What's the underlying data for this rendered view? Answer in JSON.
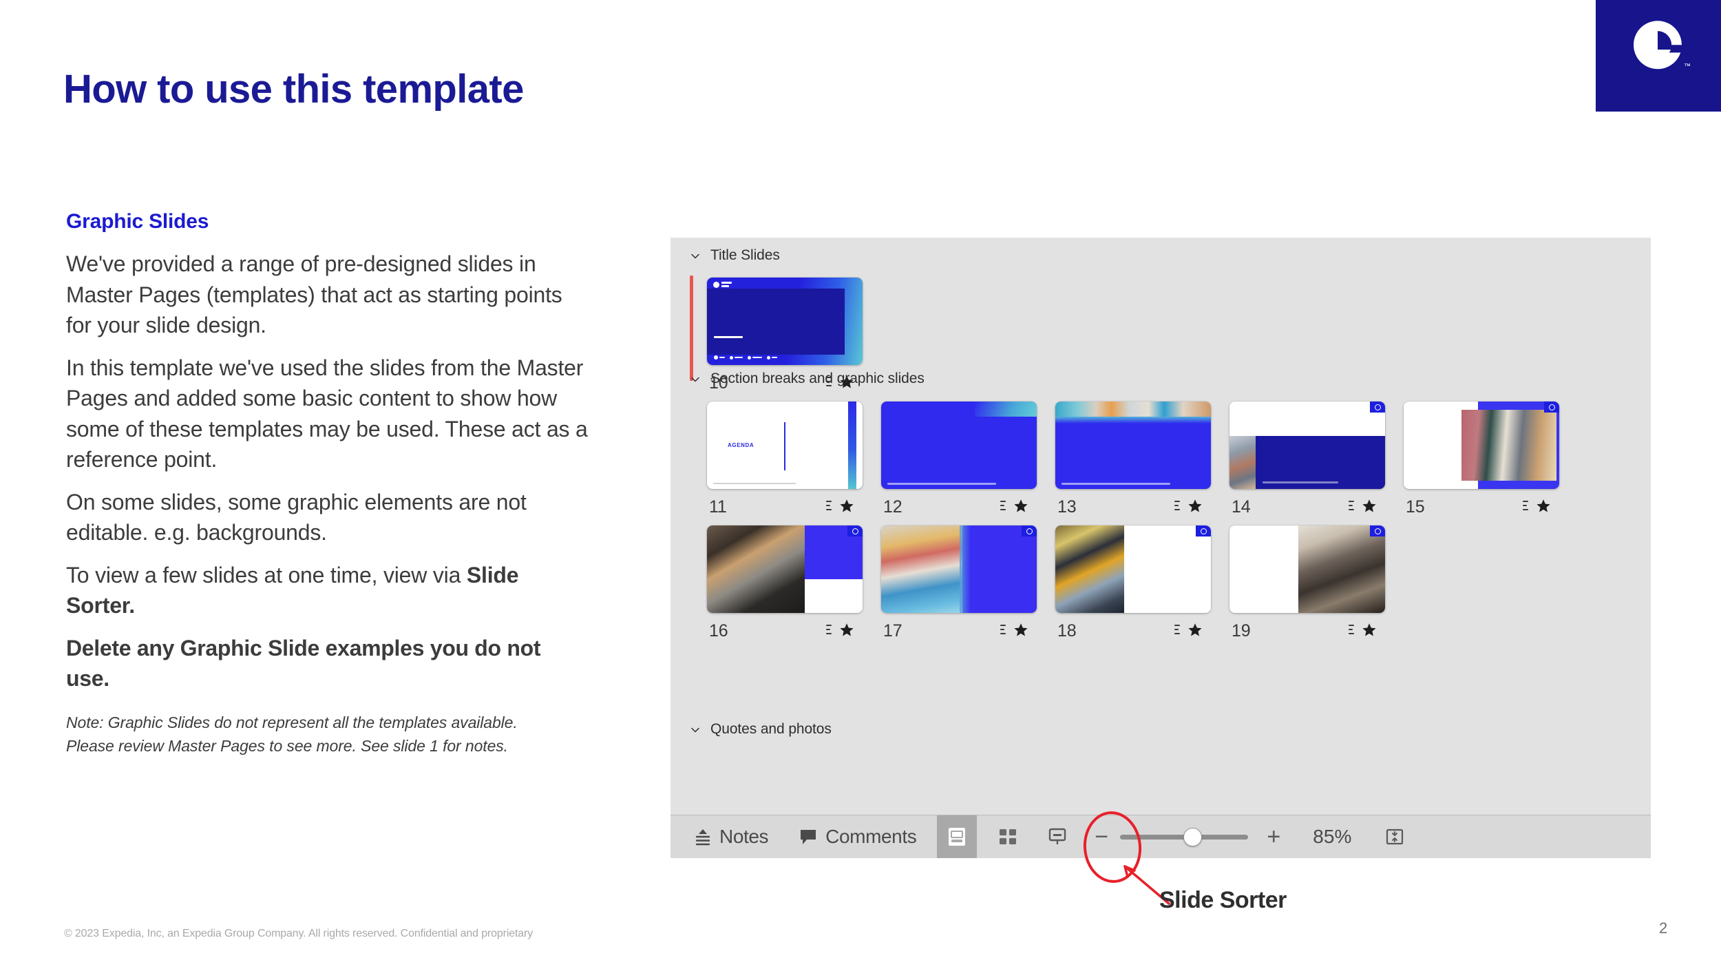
{
  "brand": {
    "logo_name": "expedia-e-logo",
    "logo_trademark": "™",
    "logo_bg": "#17148c",
    "title_color": "#1b1a95",
    "heading_color": "#1b1ad2",
    "accent_red": "#e8202a",
    "selection_red": "#e8574c"
  },
  "slide": {
    "title": "How to use this template",
    "page_number": "2",
    "footer": "© 2023 Expedia, Inc, an Expedia Group Company. All rights reserved. Confidential and proprietary"
  },
  "left_column": {
    "section_heading": "Graphic Slides",
    "paragraphs": [
      "We've provided a range of pre-designed slides in Master Pages (templates) that act as starting points for your slide design.",
      "In this template we've used the slides from the Master Pages and added some basic content to show how some of these templates may be used. These act as a reference point.",
      "On some slides, some graphic elements are not editable. e.g. backgrounds."
    ],
    "para_slide_sorter_prefix": "To view a few slides at one time, view via ",
    "para_slide_sorter_bold": "Slide Sorter.",
    "para_delete_bold": "Delete any Graphic Slide examples you do not use.",
    "note": "Note: Graphic Slides do not represent all the templates available. Please review Master Pages to see more. See slide 1 for notes."
  },
  "sorter": {
    "groups": [
      {
        "label": "Title Slides",
        "chevron": "chevron-down"
      },
      {
        "label": "Section breaks and graphic slides",
        "chevron": "chevron-down"
      },
      {
        "label": "Quotes and photos",
        "chevron": "chevron-down"
      }
    ],
    "thumbnails": [
      {
        "number": "10",
        "selected": true,
        "kind": "title-gradient"
      },
      {
        "number": "11",
        "selected": false,
        "kind": "agenda",
        "caption": "AGENDA"
      },
      {
        "number": "12",
        "selected": false,
        "kind": "solid-blue"
      },
      {
        "number": "13",
        "selected": false,
        "kind": "photo-top-blue"
      },
      {
        "number": "14",
        "selected": false,
        "kind": "navy-band-photo-left"
      },
      {
        "number": "15",
        "selected": false,
        "kind": "photo-right-framed"
      },
      {
        "number": "16",
        "selected": false,
        "kind": "photo-left-blue-right"
      },
      {
        "number": "17",
        "selected": false,
        "kind": "photo-left-blue-right-pool"
      },
      {
        "number": "18",
        "selected": false,
        "kind": "photo-left-white-right"
      },
      {
        "number": "19",
        "selected": false,
        "kind": "white-left-photo-right"
      }
    ],
    "badge_icons": [
      "transition-icon",
      "animation-star-icon"
    ]
  },
  "statusbar": {
    "notes_label": "Notes",
    "notes_icon": "notes-icon",
    "comments_label": "Comments",
    "comments_icon": "comment-bubble-icon",
    "view_normal_icon": "normal-view-icon",
    "view_sorter_icon": "slide-sorter-icon",
    "view_presenter_icon": "presenter-view-icon",
    "zoom_out_icon": "minus-icon",
    "zoom_in_icon": "plus-icon",
    "zoom_value": "85%",
    "fit_icon": "fit-to-window-icon"
  },
  "annotation": {
    "label": "Slide Sorter",
    "shape": "red-ellipse-highlight",
    "arrow": "red-arrow-pointing-up-left"
  }
}
